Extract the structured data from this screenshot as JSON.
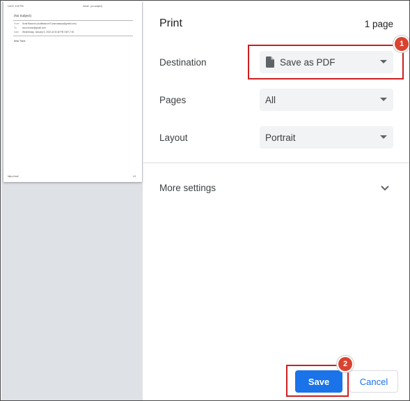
{
  "preview": {
    "header_left": "1/4/22, 5:35 PM",
    "header_right": "Gmail - (no subject)",
    "subject": "(No Subject)",
    "fields": [
      {
        "label": "From:",
        "value": "Scott Bascom (scottbascom71cannaanpa@gmail.com)"
      },
      {
        "label": "To:",
        "value": "ssco.kendo@gmail.com"
      },
      {
        "label": "Date:",
        "value": "Wednesday, January 5, 2022 at 03:45 PM GMT-7:00"
      }
    ],
    "body": "Hello There",
    "footer_left": "https://mail",
    "footer_right": "1/1"
  },
  "settings": {
    "title": "Print",
    "page_count": "1 page",
    "destination": {
      "label": "Destination",
      "value": "Save as PDF",
      "icon": "document-icon"
    },
    "pages": {
      "label": "Pages",
      "value": "All"
    },
    "layout": {
      "label": "Layout",
      "value": "Portrait"
    },
    "more_settings": {
      "label": "More settings",
      "icon": "chevron-down-icon"
    }
  },
  "actions": {
    "save_label": "Save",
    "cancel_label": "Cancel"
  },
  "annotations": {
    "badge_1": "1",
    "badge_2": "2",
    "highlight_color": "#cc1e1e",
    "badge_color": "#d9432f"
  },
  "colors": {
    "accent": "#1a73e8",
    "preview_bg": "#dee1e6",
    "select_bg": "#f1f3f4"
  }
}
